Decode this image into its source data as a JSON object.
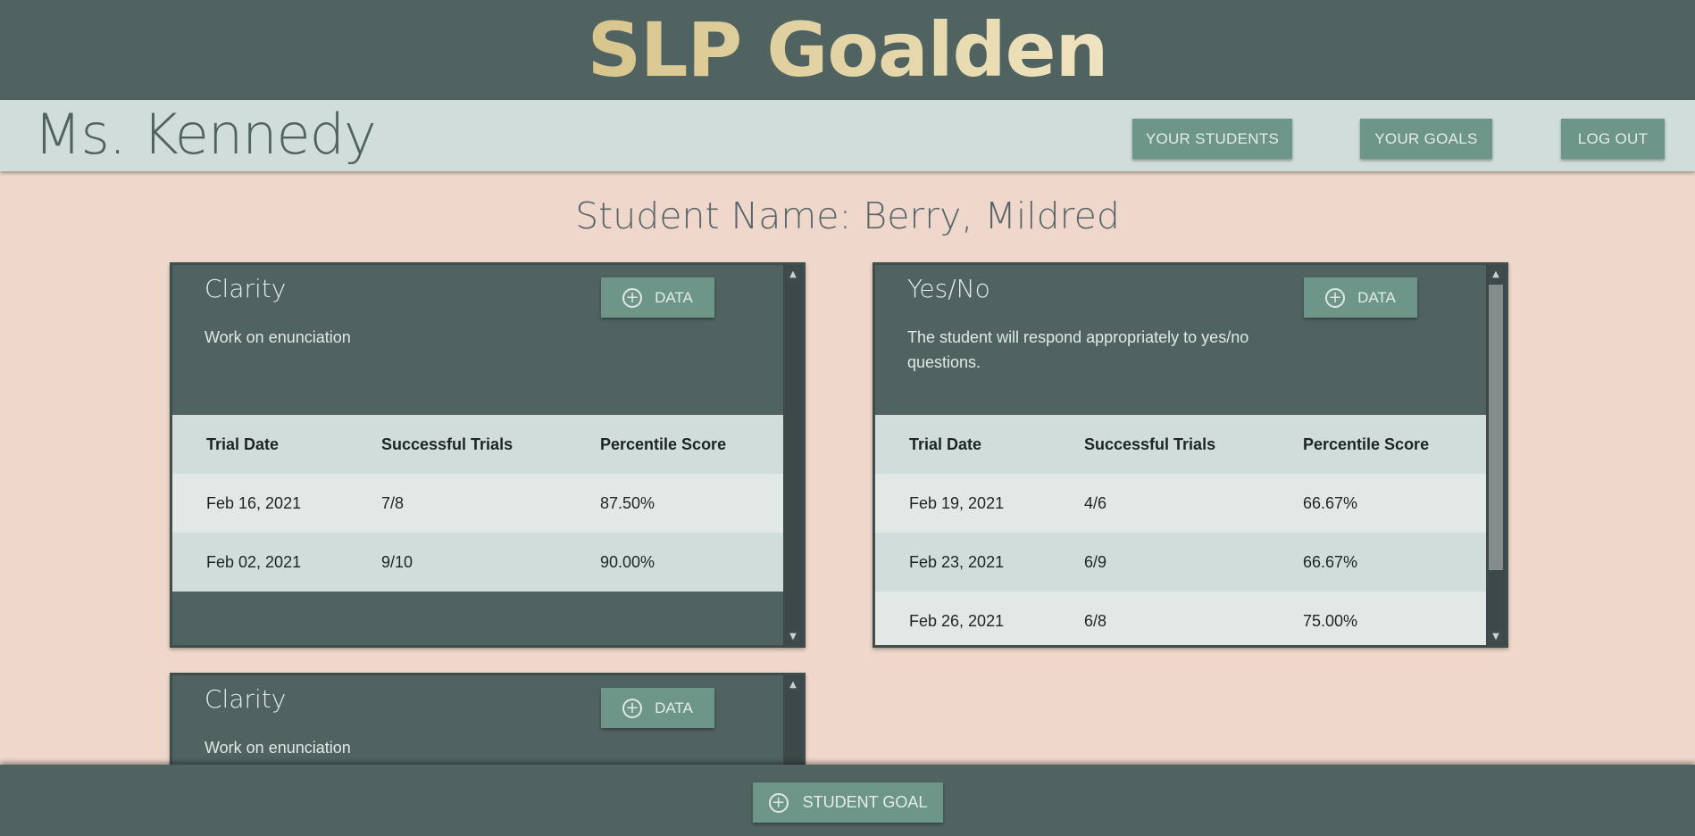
{
  "app": {
    "title": "SLP Goalden"
  },
  "teacher": {
    "name": "Ms. Kennedy"
  },
  "nav": {
    "students_label": "YOUR STUDENTS",
    "goals_label": "YOUR GOALS",
    "logout_label": "LOG OUT"
  },
  "student": {
    "heading": "Student Name: Berry, Mildred"
  },
  "table_headers": {
    "date": "Trial Date",
    "trials": "Successful Trials",
    "score": "Percentile Score"
  },
  "goals": [
    {
      "title": "Clarity",
      "description": "Work on enunciation",
      "data_button": "DATA",
      "rows": [
        {
          "date": "Feb 16, 2021",
          "trials": "7/8",
          "score": "87.50%"
        },
        {
          "date": "Feb 02, 2021",
          "trials": "9/10",
          "score": "90.00%"
        }
      ]
    },
    {
      "title": "Yes/No",
      "description": "The student will respond appropriately to yes/no questions.",
      "data_button": "DATA",
      "rows": [
        {
          "date": "Feb 19, 2021",
          "trials": "4/6",
          "score": "66.67%"
        },
        {
          "date": "Feb 23, 2021",
          "trials": "6/9",
          "score": "66.67%"
        },
        {
          "date": "Feb 26, 2021",
          "trials": "6/8",
          "score": "75.00%"
        }
      ]
    },
    {
      "title": "Clarity",
      "description": "Work on enunciation",
      "data_button": "DATA",
      "rows": []
    }
  ],
  "footer": {
    "add_goal_label": "STUDENT GOAL"
  },
  "icons": {
    "add": "plus-circle-icon",
    "scroll_up": "chevron-up-icon",
    "scroll_down": "chevron-down-icon"
  },
  "colors": {
    "primary": "#506361",
    "accent": "#6e9688",
    "background": "#efd8cb",
    "title_gold": "#e5d7a6"
  }
}
